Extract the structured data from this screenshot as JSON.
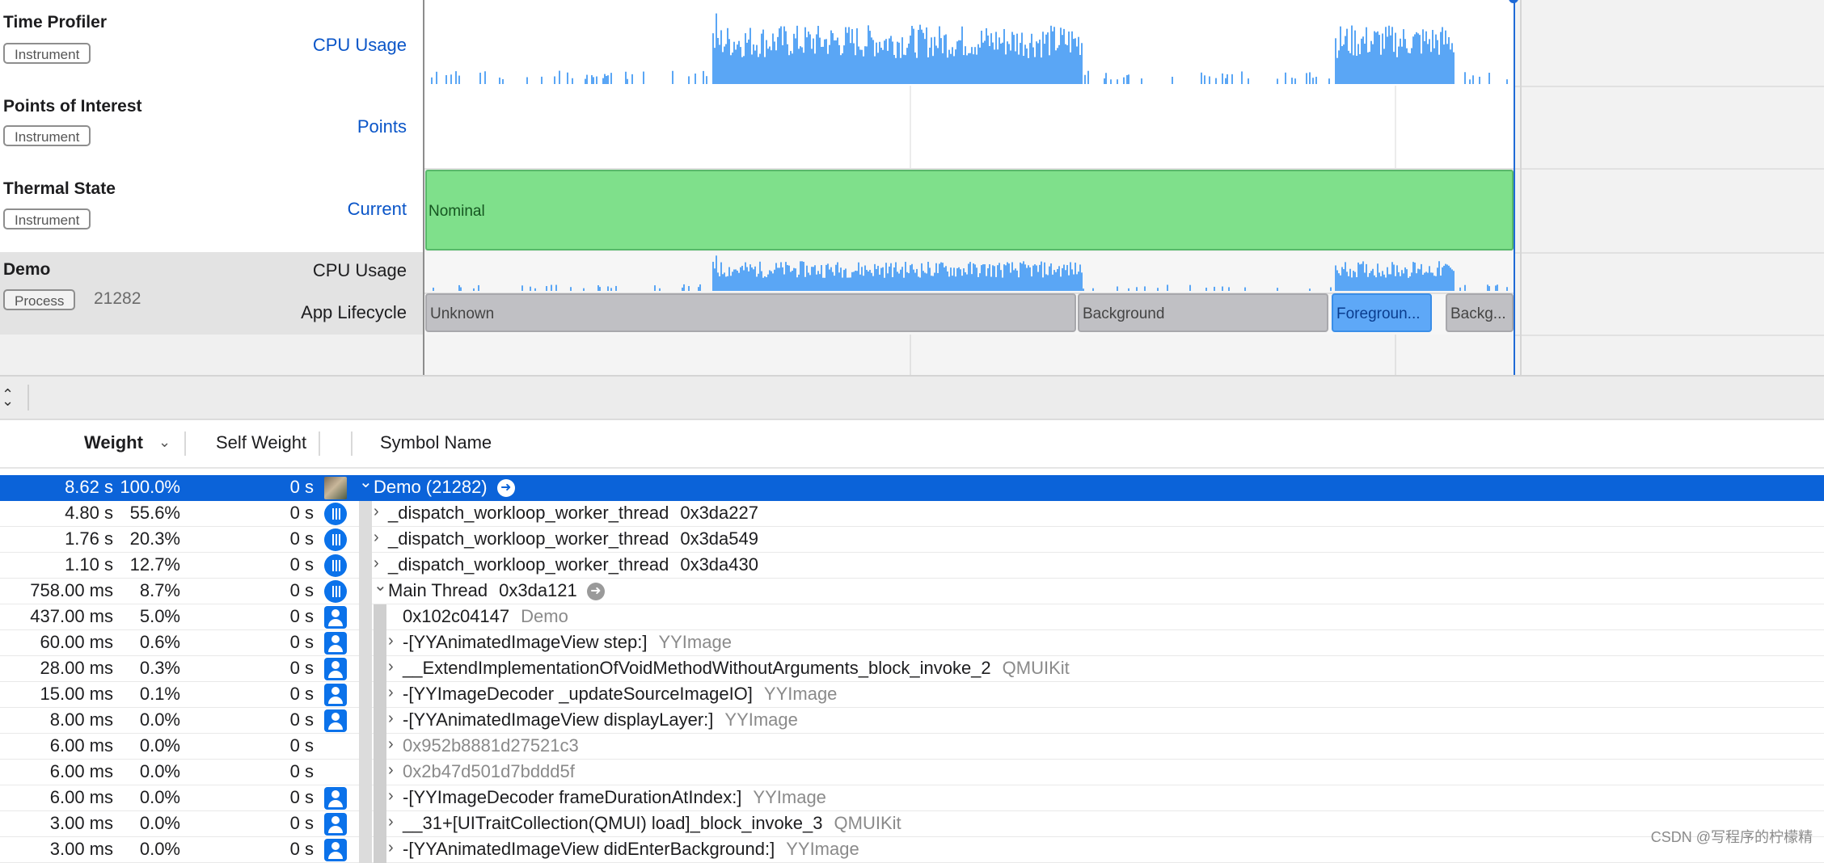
{
  "tracks": [
    {
      "name": "Time Profiler",
      "badge": "Instrument",
      "value": "CPU Usage"
    },
    {
      "name": "Points of Interest",
      "badge": "Instrument",
      "value": "Points"
    },
    {
      "name": "Thermal State",
      "badge": "Instrument",
      "value": "Current"
    }
  ],
  "thermal": {
    "state": "Nominal"
  },
  "process": {
    "name": "Demo",
    "badge": "Process",
    "pid": "21282",
    "cpu_label": "CPU Usage",
    "lifecycle_label": "App Lifecycle"
  },
  "lifecycle": [
    {
      "label": "Unknown",
      "kind": "bg"
    },
    {
      "label": "Background",
      "kind": "bg"
    },
    {
      "label": "Foregroun...",
      "kind": "fg"
    },
    {
      "label": "Backg...",
      "kind": "bg"
    }
  ],
  "columns": {
    "weight": "Weight",
    "self_weight": "Self Weight",
    "symbol": "Symbol Name"
  },
  "rows": [
    {
      "weight": "8.62 s",
      "pct": "100.0%",
      "self": "0 s",
      "icon": "avatar",
      "depth": 0,
      "disc": "v",
      "symbol": "Demo (21282)",
      "addr": "",
      "lib": "",
      "sel": true,
      "go": true
    },
    {
      "weight": "4.80 s",
      "pct": "55.6%",
      "self": "0 s",
      "icon": "thread",
      "depth": 1,
      "disc": ">",
      "symbol": "_dispatch_workloop_worker_thread",
      "addr": "0x3da227",
      "lib": ""
    },
    {
      "weight": "1.76 s",
      "pct": "20.3%",
      "self": "0 s",
      "icon": "thread",
      "depth": 1,
      "disc": ">",
      "symbol": "_dispatch_workloop_worker_thread",
      "addr": "0x3da549",
      "lib": ""
    },
    {
      "weight": "1.10 s",
      "pct": "12.7%",
      "self": "0 s",
      "icon": "thread",
      "depth": 1,
      "disc": ">",
      "symbol": "_dispatch_workloop_worker_thread",
      "addr": "0x3da430",
      "lib": ""
    },
    {
      "weight": "758.00 ms",
      "pct": "8.7%",
      "self": "0 s",
      "icon": "thread",
      "depth": 1,
      "disc": "v",
      "symbol": "Main Thread",
      "addr": "0x3da121",
      "lib": "",
      "go": true
    },
    {
      "weight": "437.00 ms",
      "pct": "5.0%",
      "self": "0 s",
      "icon": "user",
      "depth": 2,
      "disc": "",
      "symbol": "0x102c04147",
      "addr": "",
      "lib": "Demo"
    },
    {
      "weight": "60.00 ms",
      "pct": "0.6%",
      "self": "0 s",
      "icon": "user",
      "depth": 2,
      "disc": ">",
      "symbol": "-[YYAnimatedImageView step:]",
      "addr": "",
      "lib": "YYImage"
    },
    {
      "weight": "28.00 ms",
      "pct": "0.3%",
      "self": "0 s",
      "icon": "user",
      "depth": 2,
      "disc": ">",
      "symbol": "__ExtendImplementationOfVoidMethodWithoutArguments_block_invoke_2",
      "addr": "",
      "lib": "QMUIKit"
    },
    {
      "weight": "15.00 ms",
      "pct": "0.1%",
      "self": "0 s",
      "icon": "user",
      "depth": 2,
      "disc": ">",
      "symbol": "-[YYImageDecoder _updateSourceImageIO]",
      "addr": "",
      "lib": "YYImage"
    },
    {
      "weight": "8.00 ms",
      "pct": "0.0%",
      "self": "0 s",
      "icon": "user",
      "depth": 2,
      "disc": ">",
      "symbol": "-[YYAnimatedImageView displayLayer:]",
      "addr": "",
      "lib": "YYImage"
    },
    {
      "weight": "6.00 ms",
      "pct": "0.0%",
      "self": "0 s",
      "icon": "",
      "depth": 2,
      "disc": ">",
      "symbol": "0x952b8881d27521c3",
      "addr": "",
      "lib": "",
      "dim": true
    },
    {
      "weight": "6.00 ms",
      "pct": "0.0%",
      "self": "0 s",
      "icon": "",
      "depth": 2,
      "disc": ">",
      "symbol": "0x2b47d501d7bddd5f",
      "addr": "",
      "lib": "",
      "dim": true
    },
    {
      "weight": "6.00 ms",
      "pct": "0.0%",
      "self": "0 s",
      "icon": "user",
      "depth": 2,
      "disc": ">",
      "symbol": "-[YYImageDecoder frameDurationAtIndex:]",
      "addr": "",
      "lib": "YYImage"
    },
    {
      "weight": "3.00 ms",
      "pct": "0.0%",
      "self": "0 s",
      "icon": "user",
      "depth": 2,
      "disc": ">",
      "symbol": "__31+[UITraitCollection(QMUI) load]_block_invoke_3",
      "addr": "",
      "lib": "QMUIKit"
    },
    {
      "weight": "3.00 ms",
      "pct": "0.0%",
      "self": "0 s",
      "icon": "user",
      "depth": 2,
      "disc": ">",
      "symbol": "-[YYAnimatedImageView didEnterBackground:]",
      "addr": "",
      "lib": "YYImage"
    }
  ],
  "watermark": "CSDN @写程序的柠檬精",
  "colors": {
    "accent": "#0b63d9",
    "cpu_bar": "#5aa6f5",
    "thermal_nominal": "#7fe08b"
  }
}
